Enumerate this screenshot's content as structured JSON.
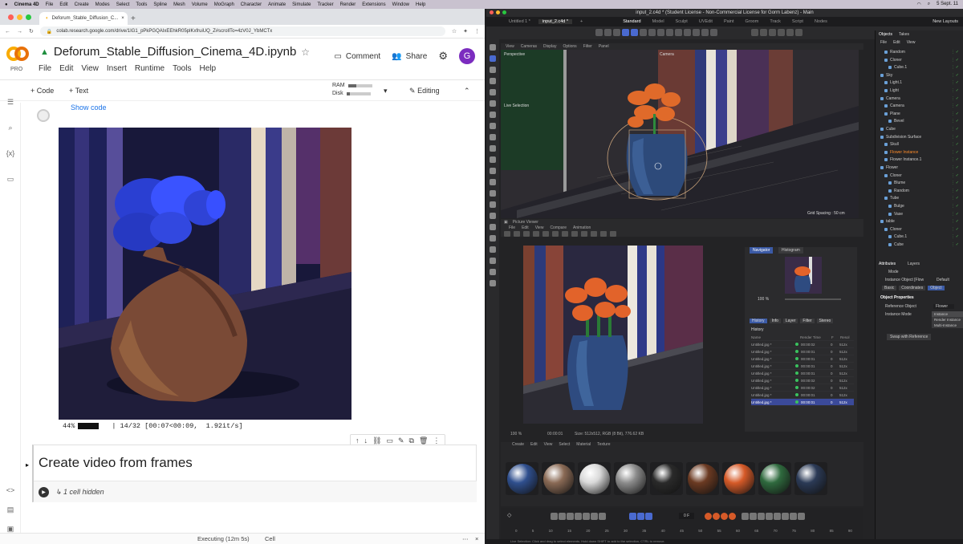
{
  "mac_menubar": {
    "app": "Cinema 4D",
    "items": [
      "File",
      "Edit",
      "Create",
      "Modes",
      "Select",
      "Tools",
      "Spline",
      "Mesh",
      "Volume",
      "MoGraph",
      "Character",
      "Animate",
      "Simulate",
      "Tracker",
      "Render",
      "Extensions",
      "Window",
      "Help"
    ],
    "clock": "5 Sept. 11"
  },
  "browser": {
    "tab_title": "Deforum_Stable_Diffusion_C...",
    "url": "colab.research.google.com/drive/1IG1_pPkPGQAIxEEhkR05plKxfruiUQ_Z#scrollTo=4zV0J_YbMCTx"
  },
  "colab": {
    "logo_label": "PRO",
    "notebook_title": "Deforum_Stable_Diffusion_Cinema_4D.ipynb",
    "menu": [
      "File",
      "Edit",
      "View",
      "Insert",
      "Runtime",
      "Tools",
      "Help"
    ],
    "comment_label": "Comment",
    "share_label": "Share",
    "avatar_letter": "G",
    "add_code": "+ Code",
    "add_text": "+ Text",
    "ram_label": "RAM",
    "disk_label": "Disk",
    "editing_label": "Editing",
    "show_code": "Show code",
    "progress": {
      "percent": "44%",
      "text": "| 14/32 [00:07<00:09,  1.92it/s]",
      "fraction": 0.44
    },
    "text_cell_title": "Create video from frames",
    "hidden_cells": "↳ 1 cell hidden",
    "status_executing": "Executing (12m 5s)",
    "status_cell": "Cell"
  },
  "c4d": {
    "window_title": "input_2.c4d * (Student License - Non-Commercial License for Gorm Labenz) - Main",
    "doc_tabs": [
      "Untitled 1 *",
      "input_2.c4d *"
    ],
    "layouts": [
      "Standard",
      "Model",
      "Sculpt",
      "UVEdit",
      "Paint",
      "Groom",
      "Track",
      "Script",
      "Nodes"
    ],
    "new_layouts": "New Layouts",
    "viewport_menu": [
      "View",
      "Cameras",
      "Display",
      "Options",
      "Filter",
      "Panel"
    ],
    "viewport_label_left": "Perspective",
    "viewport_label_cam": "Camera",
    "live_selection": "Live Selection",
    "grid_spacing": "Grid Spacing : 50 cm",
    "picture_viewer": "Picture Viewer",
    "pv_menu": [
      "File",
      "Edit",
      "View",
      "Compare",
      "Animation"
    ],
    "nav_tabs": [
      "Navigator",
      "Histogram"
    ],
    "zoom": "100 %",
    "hist_tabs": [
      "History",
      "Info",
      "Layer",
      "Filter",
      "Stereo"
    ],
    "history_title": "History",
    "history_cols": [
      "Name",
      "Render Time",
      "F",
      "Resol"
    ],
    "history_rows": [
      {
        "name": "Untitled.jpg *",
        "time": "00:00:02",
        "f": "0",
        "res": "512x"
      },
      {
        "name": "Untitled.jpg *",
        "time": "00:00:01",
        "f": "0",
        "res": "512x"
      },
      {
        "name": "Untitled.jpg *",
        "time": "00:00:01",
        "f": "0",
        "res": "512x"
      },
      {
        "name": "Untitled.jpg *",
        "time": "00:00:01",
        "f": "0",
        "res": "512x"
      },
      {
        "name": "Untitled.jpg *",
        "time": "00:00:01",
        "f": "0",
        "res": "512x"
      },
      {
        "name": "Untitled.jpg *",
        "time": "00:00:02",
        "f": "0",
        "res": "512x"
      },
      {
        "name": "Untitled.jpg *",
        "time": "00:00:02",
        "f": "0",
        "res": "512x"
      },
      {
        "name": "Untitled.jpg *",
        "time": "00:00:01",
        "f": "0",
        "res": "512x"
      },
      {
        "name": "Untitled.jpg *",
        "time": "00:00:01",
        "f": "0",
        "res": "512x"
      }
    ],
    "pv_status_zoom": "100 %",
    "pv_status_time": "00:00:01",
    "pv_status_size": "Size: 512x512, RGB (8 Bit), 776.62 KB",
    "object_tabs": [
      "Objects",
      "Takes"
    ],
    "object_menu": [
      "File",
      "Edit",
      "View"
    ],
    "objects": [
      "Random",
      "Cloner",
      "Cube.1",
      "Sky",
      "Light.1",
      "Light",
      "Camera",
      "Camera",
      "Plane",
      "Bevel",
      "Cube",
      "Subdivision Surface",
      "Skull",
      "Flower Instance",
      "Flower Instance.1",
      "Flower",
      "Cloner",
      "Blume",
      "Random",
      "Tube",
      "Bulge",
      "Vase",
      "table",
      "Cloner",
      "Cube.1",
      "Cube"
    ],
    "attr_tabs": [
      "Attributes",
      "Layers"
    ],
    "attr_mode": "Mode",
    "attr_object": "Instance Object [Flow",
    "attr_default": "Default",
    "attr_subtabs": [
      "Basic",
      "Coordinates",
      "Object"
    ],
    "object_props": "Object Properties",
    "ref_object_label": "Reference Object",
    "ref_object_value": "Flower",
    "instance_mode_label": "Instance Mode",
    "instance_options": [
      "Instance",
      "Render Instance",
      "Multi-Instance"
    ],
    "swap_btn": "Swap with Reference",
    "mat_menu": [
      "Create",
      "Edit",
      "View",
      "Select",
      "Material",
      "Texture"
    ],
    "materials": [
      "#2f4f8e",
      "#8a6a55",
      "#d9d9d9",
      "#8c8c8c",
      "#2a2a2a",
      "#6b3a22",
      "#d65a28",
      "#2f6a3e",
      "#2b3a56"
    ],
    "frame_current": "0 F",
    "frame_end": "90 F",
    "timeline_ticks": [
      "0",
      "5",
      "10",
      "15",
      "20",
      "25",
      "30",
      "35",
      "40",
      "45",
      "50",
      "55",
      "60",
      "65",
      "70",
      "75",
      "80",
      "85",
      "90"
    ],
    "bottom_hint": "Live Selection: Click and drag to select elements. Hold down SHIFT to add to the selection, CTRL to remove."
  }
}
